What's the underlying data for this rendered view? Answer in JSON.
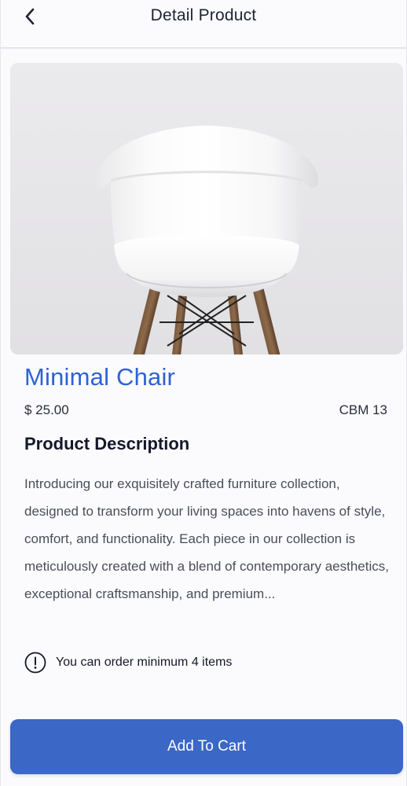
{
  "header": {
    "title": "Detail Product",
    "back_icon": "chevron-left-icon"
  },
  "product": {
    "image_alt": "white chair",
    "name": "Minimal Chair",
    "price": "$ 25.00",
    "cbm": "CBM 13",
    "description_heading": "Product Description",
    "description": "Introducing our exquisitely crafted furniture collection, designed to transform your living spaces into havens of style, comfort, and functionality. Each piece in our collection is meticulously created with a blend of contemporary aesthetics, exceptional craftsmanship, and premium...",
    "min_order_notice": "You can order minimum 4 items",
    "notice_icon": "exclamation-circle-icon"
  },
  "actions": {
    "add_to_cart_label": "Add To Cart"
  },
  "colors": {
    "accent": "#2e62d6",
    "button": "#3b67c6",
    "background": "#fbfbfd"
  }
}
